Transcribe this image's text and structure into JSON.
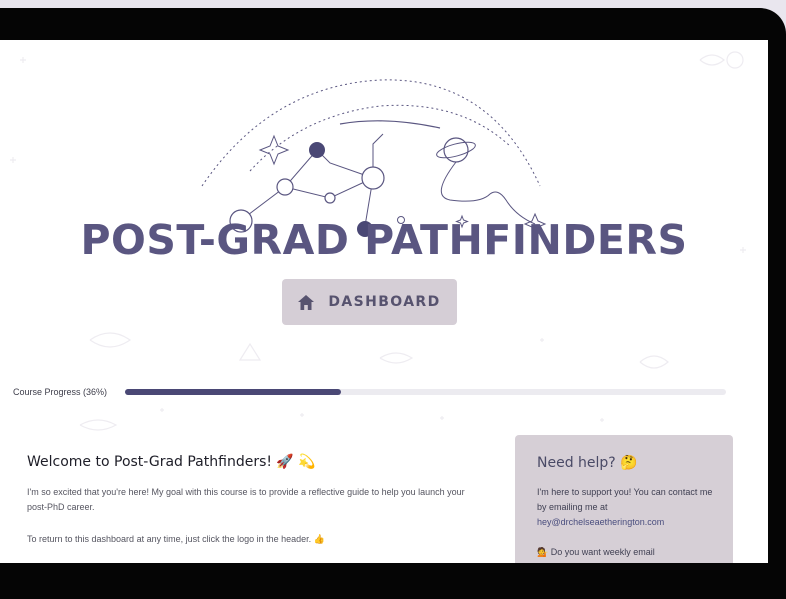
{
  "brand": {
    "title": "POST-GRAD PATHFINDERS"
  },
  "nav": {
    "dashboard_label": "DASHBOARD",
    "dashboard_icon": "home-icon"
  },
  "progress": {
    "label": "Course Progress (36%)",
    "value": 0.36
  },
  "welcome": {
    "title": "Welcome to Post-Grad Pathfinders! 🚀 💫",
    "paragraph1": "I'm so excited that you're here! My goal with this course is to provide a reflective guide to help you launch your post-PhD career.",
    "paragraph2": "To return to this dashboard at any time, just click the logo in the header. 👍"
  },
  "help": {
    "title": "Need help? 🤔",
    "body": "I'm here to support you! You can contact me by emailing me at",
    "email": "hey@drchelseaetherington.com",
    "weekly": "💁 Do you want weekly email"
  },
  "colors": {
    "brand": "#5a5681",
    "button_bg": "#d5ced6",
    "progress_fill": "#4a4875",
    "card_bg": "#d6cfd6",
    "bezel": "#050505"
  }
}
